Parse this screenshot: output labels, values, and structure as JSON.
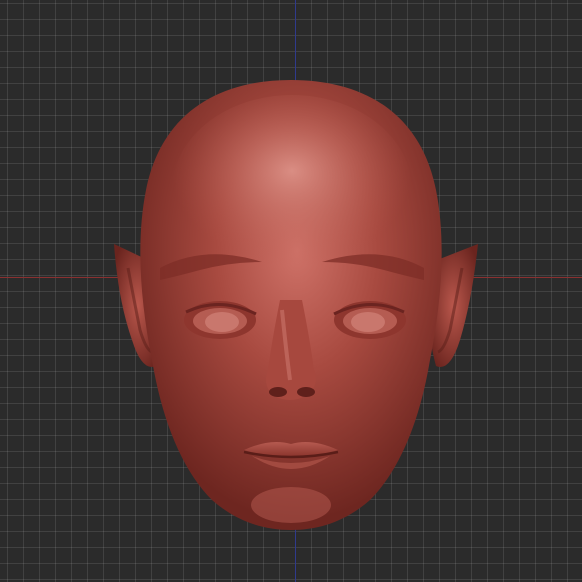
{
  "viewport": {
    "grid": true,
    "axes": [
      "x-axis",
      "y-axis"
    ],
    "background_color": "#2b2b2b",
    "axis_x_color": "#8a3030",
    "axis_y_color": "#2f3a8c"
  },
  "model": {
    "subject": "sculpted-head",
    "material_color": "#9c3f36"
  }
}
